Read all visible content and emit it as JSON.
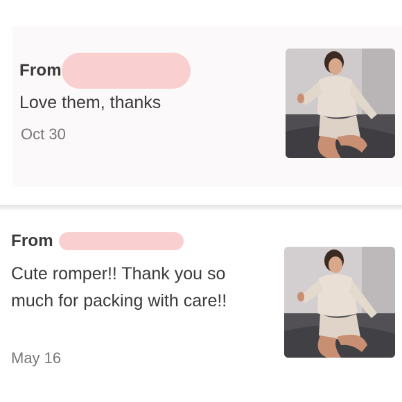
{
  "reviews": [
    {
      "from_label": "From",
      "message": "Love them, thanks",
      "date": "Oct 30",
      "image": "sequin-dress-product-photo"
    },
    {
      "from_label": "From",
      "message": "Cute romper!! Thank you so much for packing with care!!",
      "date": "May 16",
      "image": "sequin-dress-product-photo"
    }
  ],
  "colors": {
    "redaction": "#f9d0cf",
    "text": "#3a3a3a",
    "date_text": "#777777",
    "card_bg": "#fbf9fa"
  }
}
